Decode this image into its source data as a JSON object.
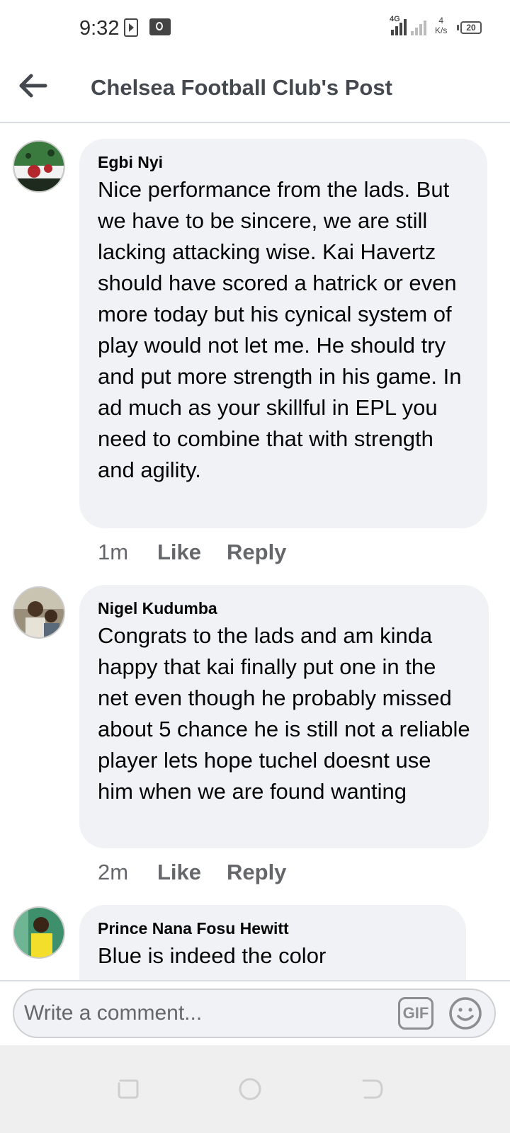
{
  "status_bar": {
    "time": "9:32",
    "network": "4G",
    "speed_value": "4",
    "speed_unit": "K/s",
    "battery": "20"
  },
  "header": {
    "title": "Chelsea Football Club's Post"
  },
  "comments": [
    {
      "author": "Egbi Nyi",
      "text": "Nice performance from the lads. But we have to be sincere, we are still lacking attacking wise. Kai Havertz should have scored a hatrick or even more today but his cynical system of play would not let me. He should try and put more strength in his game. In ad much as your skillful in EPL you need to combine that with strength and agility.",
      "time": "1m",
      "like_label": "Like",
      "reply_label": "Reply"
    },
    {
      "author": "Nigel Kudumba",
      "text": "Congrats to the lads and am kinda happy that kai finally put one in the net even though he probably missed about 5 chance he is still not a reliable player lets hope tuchel doesnt use him when we are found wanting",
      "time": "2m",
      "like_label": "Like",
      "reply_label": "Reply"
    },
    {
      "author": "Prince Nana Fosu Hewitt",
      "text": "Blue is indeed the color"
    }
  ],
  "composer": {
    "placeholder": "Write a comment...",
    "gif_label": "GIF"
  },
  "icons": {
    "back": "arrow-left-icon",
    "emoji": "smiley-icon",
    "nav_recent": "square-icon",
    "nav_home": "circle-icon",
    "nav_back": "back-icon"
  },
  "colors": {
    "bubble": "#f0f2f5",
    "secondary_text": "#65676b",
    "header_text": "#444950"
  }
}
